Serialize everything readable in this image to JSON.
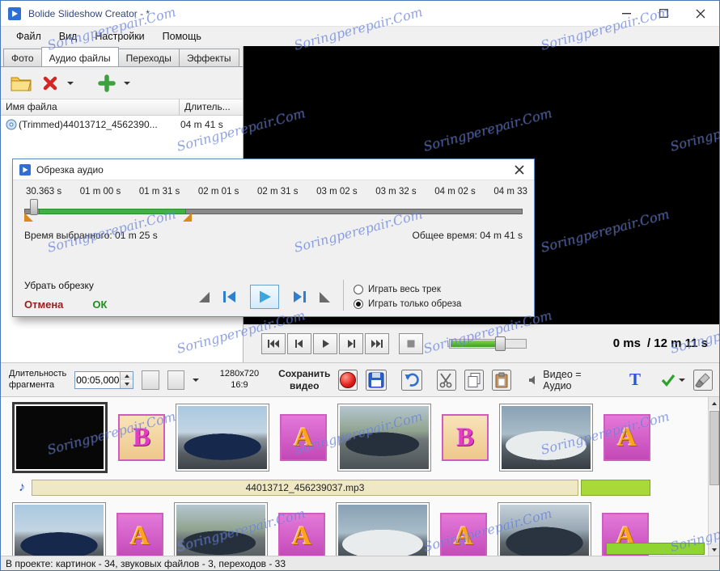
{
  "window": {
    "title": "Bolide Slideshow Creator - *"
  },
  "watermark": {
    "text": "Soringperepair.Com"
  },
  "colors": {
    "accent_blue": "#2f6fd4",
    "selection_green": "#3eb440",
    "audio_segment_green": "#a8d83a",
    "record_red": "#d42a2a",
    "watermark_blue": "#3e5ed2",
    "marker_orange": "#d98a1f"
  },
  "menu": {
    "items": [
      "Файл",
      "Вид",
      "Настройки",
      "Помощь"
    ]
  },
  "tabs": {
    "items": [
      "Фото",
      "Аудио файлы",
      "Переходы",
      "Эффекты"
    ],
    "active_index": 1
  },
  "file_list": {
    "columns": [
      "Имя файла",
      "Длитель..."
    ],
    "rows": [
      {
        "name": "(Trimmed)44013712_4562390...",
        "duration": "04 m 41 s"
      }
    ]
  },
  "dialog": {
    "title": "Обрезка аудио",
    "ticks": [
      "30.363 s",
      "01 m 00 s",
      "01 m 31 s",
      "02 m 01 s",
      "02 m 31 s",
      "03 m 02 s",
      "03 m 32 s",
      "04 m 02 s",
      "04 m 33"
    ],
    "selected_time": "Время выбранного: 01 m 25 s",
    "total_time": "Общее время: 04 m 41 s",
    "remove_trim_label": "Убрать обрезку",
    "cancel_label": "Отмена",
    "ok_label": "ОК",
    "radio_full": "Играть весь трек",
    "radio_trimmed": "Играть только обреза"
  },
  "transport": {
    "current": "0 ms",
    "total": "/ 12 m 11 s"
  },
  "toolbar": {
    "duration_label_line1": "Длительность",
    "duration_label_line2": "фрагмента",
    "duration_value": "00:05,000",
    "resolution": "1280x720",
    "aspect_ratio": "16:9",
    "save_video_line1": "Сохранить",
    "save_video_line2": "видео",
    "video_audio_label": "Видео = Аудио",
    "text_tool_label": "T"
  },
  "storyboard": {
    "audio_track": "44013712_456239037.mp3",
    "row1": [
      {
        "type": "photo",
        "variant": "black",
        "selected": true
      },
      {
        "type": "letter",
        "letter": "B",
        "style": "beige"
      },
      {
        "type": "photo",
        "variant": "car-blue"
      },
      {
        "type": "letter",
        "letter": "A",
        "style": "magenta"
      },
      {
        "type": "photo",
        "variant": "car-road"
      },
      {
        "type": "letter",
        "letter": "B",
        "style": "beige"
      },
      {
        "type": "photo",
        "variant": "car-white"
      },
      {
        "type": "letter",
        "letter": "A",
        "style": "magenta"
      }
    ],
    "row2": [
      {
        "type": "photo",
        "variant": "car-blue"
      },
      {
        "type": "letter",
        "letter": "A",
        "style": "magenta"
      },
      {
        "type": "photo",
        "variant": "car-road"
      },
      {
        "type": "letter",
        "letter": "A",
        "style": "magenta"
      },
      {
        "type": "photo",
        "variant": "car-white"
      },
      {
        "type": "letter",
        "letter": "A",
        "style": "magenta"
      },
      {
        "type": "photo",
        "variant": "car-rear"
      },
      {
        "type": "letter",
        "letter": "A",
        "style": "magenta"
      }
    ]
  },
  "status": {
    "text": "В проекте: картинок - 34, звуковых файлов - 3, переходов - 33"
  }
}
